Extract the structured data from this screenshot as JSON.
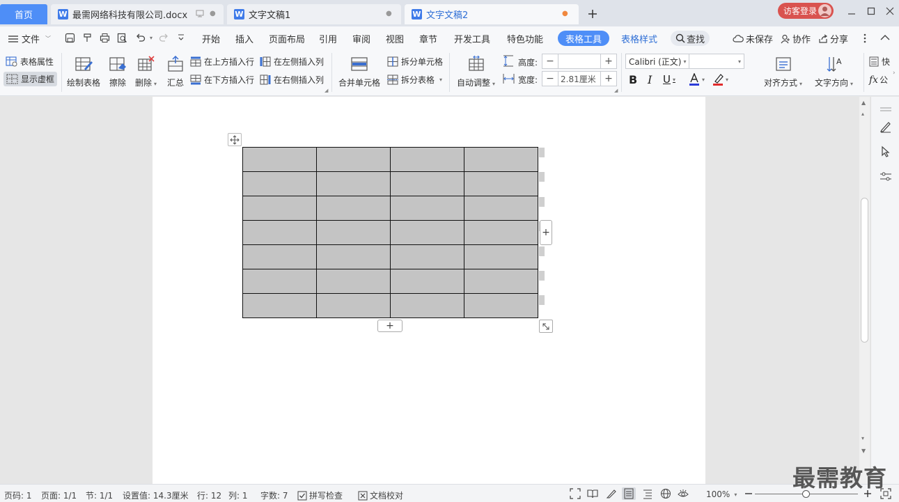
{
  "tabs": {
    "home": "首页",
    "doc1": "最需网络科技有限公司.docx",
    "doc2": "文字文稿1",
    "doc3": "文字文稿2",
    "login": "访客登录"
  },
  "menu": {
    "file": "文件",
    "items": [
      "开始",
      "插入",
      "页面布局",
      "引用",
      "审阅",
      "视图",
      "章节",
      "开发工具",
      "特色功能"
    ],
    "table_tools": "表格工具",
    "table_style": "表格样式",
    "search": "查找",
    "unsaved": "未保存",
    "collab": "协作",
    "share": "分享"
  },
  "ribbon": {
    "table_props": "表格属性",
    "show_gridlines": "显示虚框",
    "draw_table": "绘制表格",
    "erase": "擦除",
    "delete": "删除",
    "summary": "汇总",
    "insert_above": "在上方插入行",
    "insert_below": "在下方插入行",
    "insert_left": "在左侧插入列",
    "insert_right": "在右侧插入列",
    "merge_cells": "合并单元格",
    "split_cells": "拆分单元格",
    "split_table": "拆分表格",
    "auto_fit": "自动调整",
    "height_label": "高度:",
    "height_value": "",
    "width_label": "宽度:",
    "width_value": "2.81厘米",
    "font_name": "Calibri (正文)",
    "font_size": "",
    "align": "对齐方式",
    "text_direction": "文字方向",
    "quick": "快",
    "formula": "公"
  },
  "table": {
    "rows": 7,
    "cols": 4,
    "cell_color": "#c4c4c4"
  },
  "status": {
    "page_num": "页码: 1",
    "pages": "页面: 1/1",
    "section": "节: 1/1",
    "setting": "设置值: 14.3厘米",
    "row": "行: 12",
    "col": "列: 1",
    "word_count": "字数: 7",
    "spell_check": "拼写检查",
    "doc_proof": "文档校对",
    "zoom": "100%",
    "zoom_level": 0.5
  },
  "watermark": "最需教育",
  "colors": {
    "accent": "#4e8ef7",
    "login": "#d9534f"
  }
}
